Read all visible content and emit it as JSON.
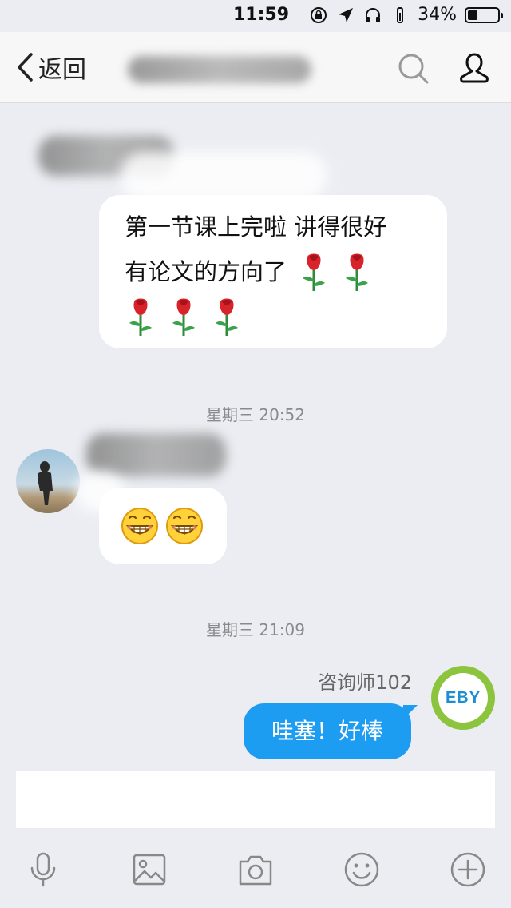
{
  "status_bar": {
    "time": "11:59",
    "battery": "34%",
    "battery_level": 0.34
  },
  "nav": {
    "back_label": "返回"
  },
  "messages": {
    "first": {
      "lines": [
        "第一节课上完啦 讲得很好",
        "有论文的方向了"
      ],
      "rose_count_line2": 2,
      "rose_count_line3": 3
    },
    "time1": "星期三 20:52",
    "second_emoji_count": 2,
    "time2": "星期三 21:09",
    "reply": {
      "sender": "咨询师102",
      "text": "哇塞！好棒",
      "avatar_logo": "EBY"
    }
  },
  "colors": {
    "accent": "#1d9df2",
    "background": "#ebedf2",
    "avatar_ring": "#8cc43e"
  },
  "icons": [
    "mic-icon",
    "image-icon",
    "camera-icon",
    "emoji-icon",
    "plus-icon"
  ]
}
